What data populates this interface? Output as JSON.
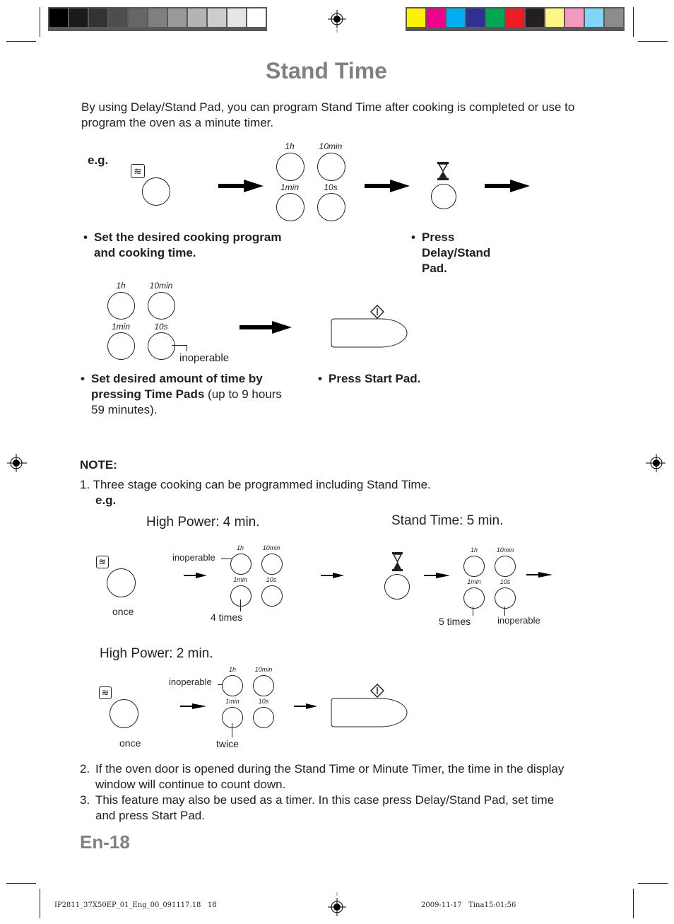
{
  "print_marks": {
    "gray_swatches": [
      "#000000",
      "#1a1a1a",
      "#333333",
      "#4d4d4d",
      "#666666",
      "#808080",
      "#999999",
      "#b3b3b3",
      "#cccccc",
      "#e6e6e6",
      "#ffffff"
    ],
    "color_swatches": [
      "#fff200",
      "#ec008c",
      "#00aeef",
      "#2e3192",
      "#00a651",
      "#ed1c24",
      "#231f20",
      "#fff685",
      "#f49ac1",
      "#7fd6f7",
      "#8c8c8c"
    ]
  },
  "page": {
    "title": "Stand Time",
    "intro": "By using Delay/Stand Pad, you can program Stand Time after cooking is completed or use to program the oven as a minute timer.",
    "eg_label": "e.g.",
    "pad_labels": {
      "h1": "1h",
      "min10": "10min",
      "min1": "1min",
      "s10": "10s"
    },
    "step1": {
      "bold": "Set the desired cooking program and cooking time."
    },
    "step2": {
      "bold": "Press Delay/Stand Pad."
    },
    "step3": {
      "bold": "Set desired amount of time by pressing Time Pads",
      "normal": " (up to 9 hours 59 minutes)."
    },
    "step4": {
      "bold": "Press Start Pad."
    },
    "inoperable": "inoperable",
    "note_heading": "NOTE:",
    "note1": "1.  Three stage cooking can be programmed including Stand Time.",
    "note1_eg": "e.g.",
    "example": {
      "stage1_heading": "High Power: 4 min.",
      "stage2_heading": "Stand Time: 5 min.",
      "stage3_heading": "High Power: 2 min.",
      "once": "once",
      "four_times": "4 times",
      "five_times": "5 times",
      "twice": "twice"
    },
    "note2_num": "2.",
    "note2": "If the oven door is opened during the Stand Time or Minute Timer, the time in the display window will continue to count down.",
    "note3_num": "3.",
    "note3": "This feature may also be used as a timer. In this case press Delay/Stand Pad, set time and press Start Pad.",
    "page_number": "En-18"
  },
  "footer": {
    "file": "IP2811_37X50EP_01_Eng_00_091117.18   18",
    "date": "2009-11-17   Tina15:01:56"
  }
}
